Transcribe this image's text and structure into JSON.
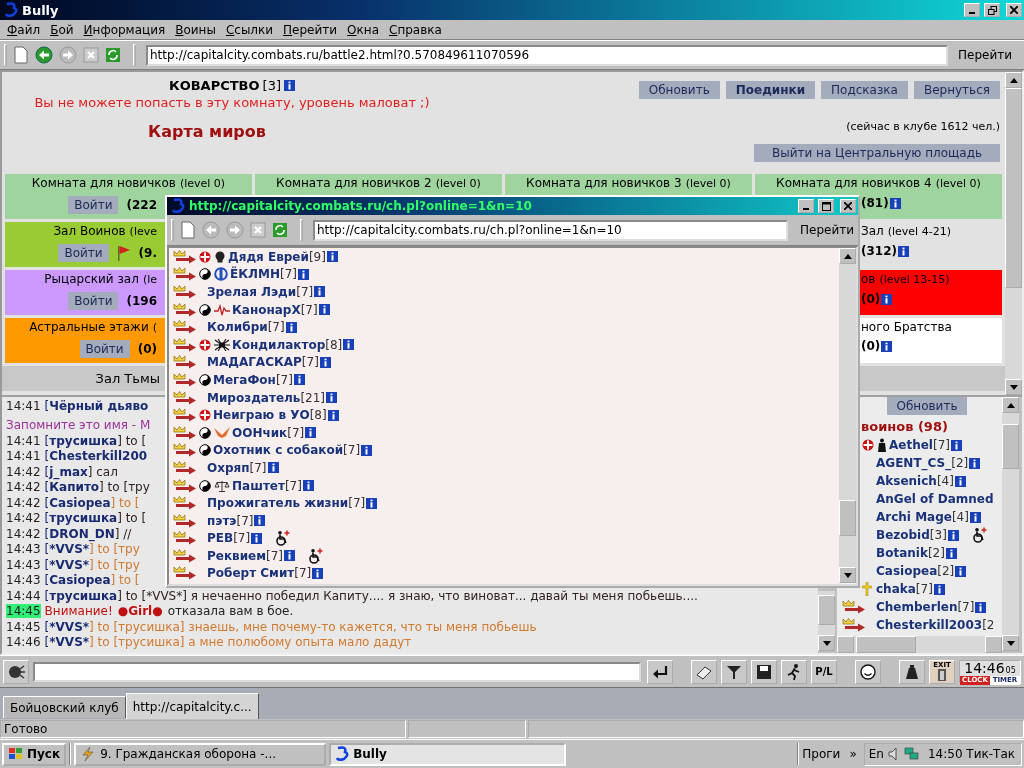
{
  "window": {
    "title": "Bully"
  },
  "menu": [
    "Файл",
    "Бой",
    "Информация",
    "Воины",
    "Ссылки",
    "Перейти",
    "Окна",
    "Справка"
  ],
  "toolbar": {
    "address": "http://capitalcity.combats.ru/battle2.html?0.570849611070596",
    "go": "Перейти"
  },
  "page": {
    "location": "КОВАРСТВО",
    "location_count": "[3]",
    "warning": "Вы не можете попасть в эту комнату, уровень маловат ;)",
    "heading": "Карта миров",
    "buttons": [
      {
        "label": "Обновить",
        "selected": false
      },
      {
        "label": "Поединки",
        "selected": true
      },
      {
        "label": "Подсказка",
        "selected": false
      },
      {
        "label": "Вернуться",
        "selected": false
      }
    ],
    "online": "(сейчас в клубе 1612 чел.)",
    "exit_button": "Выйти на Центральную площадь",
    "rooms": [
      {
        "cells": [
          {
            "title": "Комната для новичков",
            "range": "(level 0)",
            "enter": "Войти",
            "count": "(222",
            "info": false,
            "color": "#9fd49f"
          },
          {
            "title": "Комната для новичков 2",
            "range": "(level 0)",
            "info": false,
            "color": "#9fd49f"
          },
          {
            "title": "Комната для новичков 3",
            "range": "(level 0)",
            "info": false,
            "color": "#9fd49f"
          },
          {
            "title": "Комната для новичков 4",
            "range": "(level 0)",
            "count": "(81)",
            "info": true,
            "color": "#9fd49f"
          }
        ]
      },
      {
        "cells": [
          {
            "title": "Зал Воинов",
            "range": "(leve",
            "enter": "Войти",
            "flag": true,
            "count": "(9.",
            "info": false,
            "color": "#99cc33"
          },
          null,
          null,
          {
            "title": "Зал",
            "range": "(level 4-21)",
            "count": "(312)",
            "info": true,
            "color": "#e2e2e2"
          }
        ]
      },
      {
        "cells": [
          {
            "title": "Рыцарский зал",
            "range": "(le",
            "enter": "Войти",
            "count": "(196",
            "info": false,
            "color": "#cc99ff"
          },
          null,
          null,
          {
            "title": "ов",
            "range": "(level 13-15)",
            "count": "(0)",
            "info": true,
            "color": "#ff0000"
          }
        ]
      },
      {
        "cells": [
          {
            "title": "Астральные этажи",
            "range": "(",
            "enter": "Войти",
            "count": "(0)",
            "info": false,
            "color": "#ff9900"
          },
          null,
          null,
          {
            "title": "ного Братства",
            "count": "(0)",
            "info": true,
            "color": "#ffffff"
          }
        ]
      }
    ],
    "dark_hall": "Зал Тьмы"
  },
  "chat": [
    {
      "kind": "public",
      "time": "14:41",
      "pre": "[",
      "nick": "Чёрный дьяво"
    },
    {
      "kind": "system",
      "text": "Запомните это имя - М"
    },
    {
      "kind": "public",
      "time": "14:41",
      "pre": "[",
      "nick": "трусишка",
      "post": "] to ["
    },
    {
      "kind": "public",
      "time": "14:41",
      "pre": "[",
      "nick": "Chesterkill200"
    },
    {
      "kind": "public",
      "time": "14:42",
      "pre": "[",
      "nick": "j_max",
      "post": "] сал"
    },
    {
      "kind": "public",
      "time": "14:42",
      "pre": "[",
      "nick": "Капито",
      "post": "] to [тру"
    },
    {
      "kind": "private",
      "time": "14:42",
      "pre": "[",
      "nick": "Casiopea",
      "post": "] to ["
    },
    {
      "kind": "public",
      "time": "14:42",
      "pre": "[",
      "nick": "трусишка",
      "post": "] to ["
    },
    {
      "kind": "public",
      "time": "14:42",
      "pre": "[",
      "nick": "DRON_DN",
      "post": "] //"
    },
    {
      "kind": "private",
      "time": "14:43",
      "pre": "[",
      "nick": "*VVS*",
      "post": "] to [тру"
    },
    {
      "kind": "private",
      "time": "14:43",
      "pre": "[",
      "nick": "*VVS*",
      "post": "] to [тру"
    },
    {
      "kind": "private",
      "time": "14:43",
      "pre": "[",
      "nick": "Casiopea",
      "post": "] to ["
    },
    {
      "kind": "public",
      "time": "14:44",
      "pre": "[",
      "nick": "трусишка",
      "post": "] to [*VVS*] я нечаенно победил Капиту.... я знаю, что виноват... давай ты меня побьешь...."
    },
    {
      "kind": "notice",
      "time": "14:45",
      "pre": "Внимание!",
      "nick": "●Girl●",
      "post": "отказала вам в бое."
    },
    {
      "kind": "private",
      "time": "14:45",
      "pre": "[",
      "nick": "*VVS*",
      "post": "] to [трусишка] знаешь, мне почему-то кажется, что ты меня побьешь"
    },
    {
      "kind": "private",
      "time": "14:46",
      "pre": "[",
      "nick": "*VVS*",
      "post": "] to [трусишка] а мне полюбому опыта мало дадут"
    }
  ],
  "online_panel": {
    "refresh": "Обновить",
    "title": "воинов (98)",
    "users": [
      {
        "name": "Aethel",
        "rank": "[7]",
        "icons": [
          {
            "kind": "cross"
          },
          {
            "kind": "figure"
          }
        ],
        "arrow": false,
        "info": true
      },
      {
        "name": "AGENT_CS_",
        "rank": "[2]",
        "arrow": false,
        "info": true
      },
      {
        "name": "Aksenich",
        "rank": "[4]",
        "arrow": false,
        "info": true
      },
      {
        "name": "AnGel of Damned",
        "arrow": false,
        "info": false
      },
      {
        "name": "Archi Mage",
        "rank": "[4]",
        "arrow": false,
        "info": true
      },
      {
        "name": "Bezobid",
        "rank": "[3]",
        "arrow": false,
        "info": true,
        "trail": [
          {
            "kind": "wheelchair"
          }
        ]
      },
      {
        "name": "Botanik",
        "rank": "[2]",
        "arrow": false,
        "info": true
      },
      {
        "name": "Casiopea",
        "rank": "[2]",
        "arrow": false,
        "info": true
      },
      {
        "name": "chaka",
        "rank": "[7]",
        "icons": [
          {
            "kind": "holy"
          }
        ],
        "arrow": false,
        "info": true
      },
      {
        "name": "Chemberlen",
        "rank": "[7]",
        "arrow": true,
        "info": true
      },
      {
        "name": "Chesterkill2003",
        "rank": "[2",
        "arrow": true,
        "info": false
      }
    ]
  },
  "chat_bar": {
    "pl": "P/L",
    "exit": "EXIT",
    "time": "14:46",
    "seconds": "05",
    "clock": "CLOCK",
    "timer": "TIMER"
  },
  "tabs": [
    {
      "label": "Бойцовский клуб",
      "selected": false
    },
    {
      "label": "http://capitalcity.c...",
      "selected": true
    }
  ],
  "status_bar": "Готово",
  "popup": {
    "title": "http://capitalcity.combats.ru/ch.pl?online=1&n=10",
    "address": "http://capitalcity.combats.ru/ch.pl?online=1&n=10",
    "go": "Перейти",
    "users": [
      {
        "name": "Дядя Еврей",
        "rank": "[9]",
        "icons": [
          {
            "kind": "cross"
          },
          {
            "kind": "skull"
          }
        ],
        "arrow": true,
        "info": true
      },
      {
        "name": "ЁКЛМН",
        "rank": "[7]",
        "icons": [
          {
            "kind": "yinyang"
          },
          {
            "kind": "emblem"
          }
        ],
        "arrow": true,
        "info": true
      },
      {
        "name": "Зрелая Лэди",
        "rank": "[7]",
        "arrow": true,
        "info": true
      },
      {
        "name": "КанонарХ",
        "rank": "[7]",
        "icons": [
          {
            "kind": "yinyang"
          },
          {
            "kind": "pulse"
          }
        ],
        "arrow": true,
        "info": true
      },
      {
        "name": "Колибри",
        "rank": "[7]",
        "arrow": true,
        "info": true
      },
      {
        "name": "Кондилактор",
        "rank": "[8]",
        "icons": [
          {
            "kind": "cross"
          },
          {
            "kind": "spider"
          }
        ],
        "arrow": true,
        "info": true
      },
      {
        "name": "МАДАГАСКАР",
        "rank": "[7]",
        "arrow": true,
        "info": true
      },
      {
        "name": "МегаФон",
        "rank": "[7]",
        "icons": [
          {
            "kind": "yinyang"
          }
        ],
        "arrow": true,
        "info": true
      },
      {
        "name": "Мироздатель",
        "rank": "[21]",
        "arrow": true,
        "info": true
      },
      {
        "name": "Неиграю в УО",
        "rank": "[8]",
        "icons": [
          {
            "kind": "cross"
          }
        ],
        "arrow": true,
        "info": true
      },
      {
        "name": "ООНчик",
        "rank": "[7]",
        "icons": [
          {
            "kind": "yinyang"
          },
          {
            "kind": "bird"
          }
        ],
        "arrow": true,
        "info": true
      },
      {
        "name": "Охотник с собакой",
        "rank": "[7]",
        "icons": [
          {
            "kind": "yinyang"
          }
        ],
        "arrow": true,
        "info": true
      },
      {
        "name": "Охряп",
        "rank": "[7]",
        "arrow": true,
        "info": true
      },
      {
        "name": "Паштет",
        "rank": "[7]",
        "icons": [
          {
            "kind": "yinyang"
          },
          {
            "kind": "scales"
          }
        ],
        "arrow": true,
        "info": true
      },
      {
        "name": "Прожигатель жизни",
        "rank": "[7]",
        "arrow": true,
        "info": true
      },
      {
        "name": "пэтэ",
        "rank": "[7]",
        "arrow": true,
        "info": true
      },
      {
        "name": "РЕВ",
        "rank": "[7]",
        "arrow": true,
        "info": true,
        "trail": [
          {
            "kind": "wheelchair"
          }
        ]
      },
      {
        "name": "Реквием",
        "rank": "[7]",
        "arrow": true,
        "info": true,
        "trail": [
          {
            "kind": "wheelchair"
          }
        ]
      },
      {
        "name": "Роберт Смит",
        "rank": "[7]",
        "arrow": true,
        "info": true
      }
    ]
  },
  "taskbar": {
    "start": "Пуск",
    "tasks": [
      {
        "label": "9. Гражданская оборона -...",
        "selected": false
      },
      {
        "label": "Bully",
        "selected": true
      }
    ],
    "toolbar": "Проги",
    "more": "»",
    "language": "En",
    "clock": "14:50 Тик-Так"
  }
}
